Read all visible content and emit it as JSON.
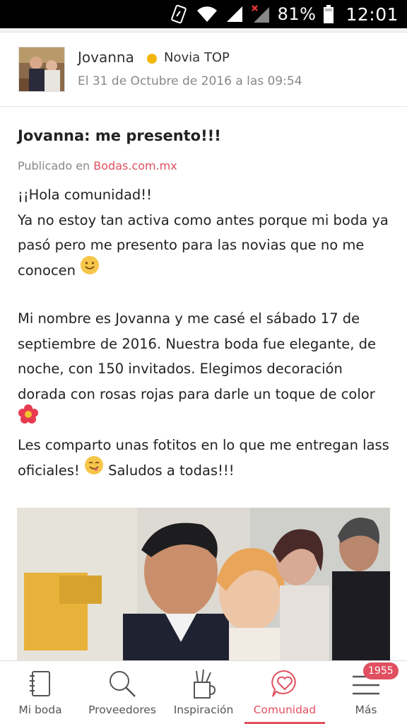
{
  "status_bar": {
    "battery": "81%",
    "time": "12:01",
    "icons": [
      "nfc-icon",
      "wifi-icon",
      "signal-icon",
      "signal-off-icon",
      "battery-icon"
    ]
  },
  "author": {
    "name": "Jovanna",
    "badge": "Novia TOP",
    "badge_color": "#f2b705",
    "date": "El 31 de Octubre de 2016 a las 09:54"
  },
  "post": {
    "title": "Jovanna: me presento!!!",
    "published_prefix": "Publicado en",
    "published_site": "Bodas.com.mx",
    "paragraph1": {
      "line1": "¡¡Hola comunidad!!",
      "line2": "Ya no estoy tan activa como antes porque mi boda ya pasó pero me presento para las novias que no me conocen",
      "emoji": "smile-emoji-icon"
    },
    "paragraph2": {
      "text": "Mi nombre es Jovanna y me casé el sábado 17 de septiembre de 2016. Nuestra boda fue elegante, de noche, con 150 invitados. Elegimos decoración dorada con rosas rojas para darle un toque de color",
      "emoji": "flower-emoji-icon"
    },
    "paragraph3": {
      "text_before": "Les comparto unas fotitos en lo que me entregan lass oficiales!",
      "text_after": "Saludos a todas!!!",
      "emoji": "yum-emoji-icon"
    },
    "photo": "wedding-photo"
  },
  "bottom_nav": {
    "items": [
      {
        "label": "Mi boda",
        "icon": "notebook-icon"
      },
      {
        "label": "Proveedores",
        "icon": "search-icon"
      },
      {
        "label": "Inspiración",
        "icon": "pencil-cup-icon"
      },
      {
        "label": "Comunidad",
        "icon": "heart-chat-icon",
        "active": true
      },
      {
        "label": "Más",
        "icon": "menu-icon"
      }
    ],
    "more_badge": "1955"
  },
  "colors": {
    "accent": "#e05060",
    "status_bar": "#000000"
  }
}
